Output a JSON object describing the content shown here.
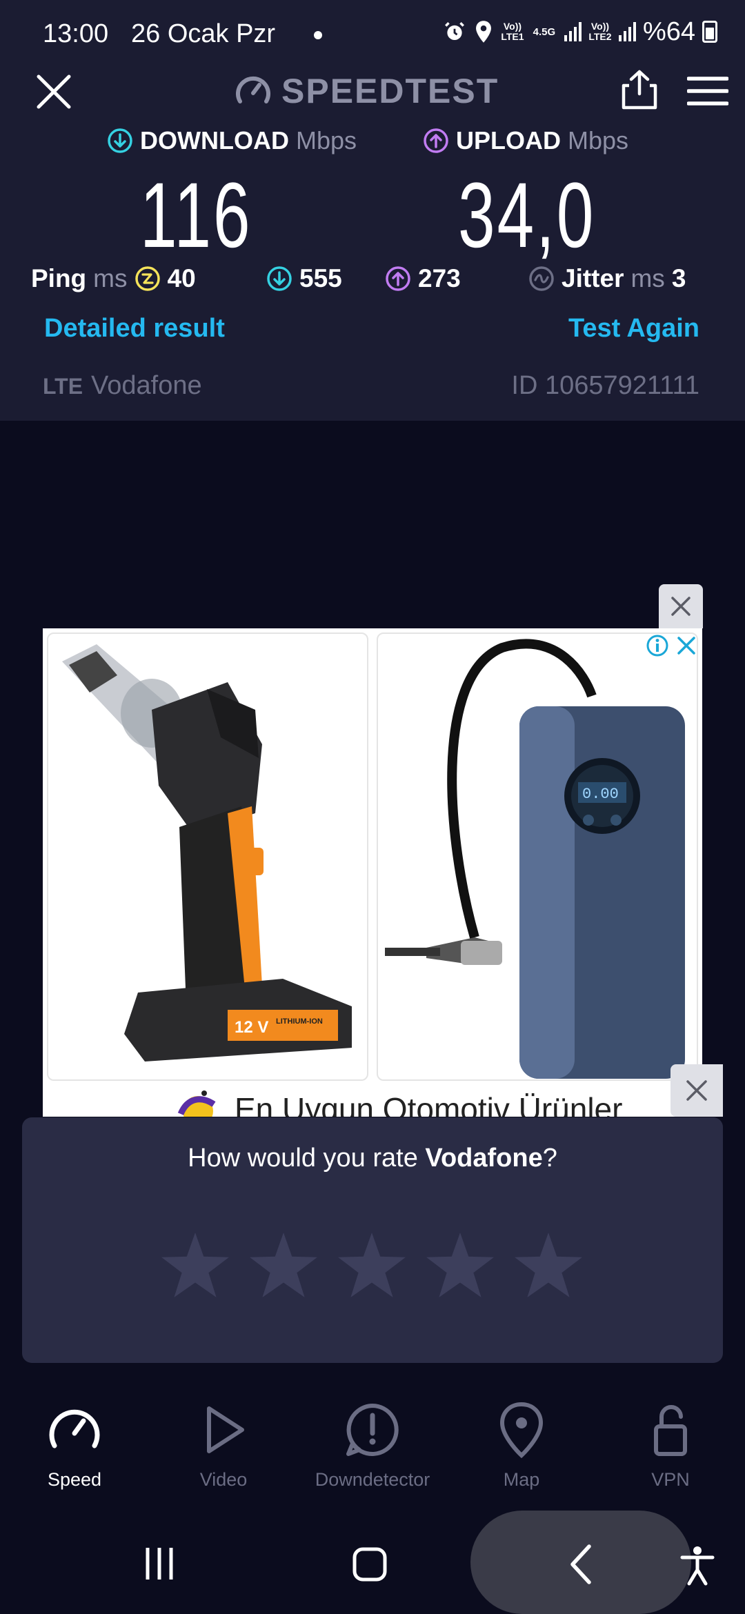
{
  "status_bar": {
    "time": "13:00",
    "date": "26 Ocak Pzr",
    "net1": "Vo)) LTE1",
    "net_type": "4.5G",
    "net2": "Vo)) LTE2",
    "battery": "%64"
  },
  "header": {
    "brand": "SPEEDTEST"
  },
  "results": {
    "download_label": "DOWNLOAD",
    "download_unit": "Mbps",
    "download_value": "116",
    "upload_label": "UPLOAD",
    "upload_unit": "Mbps",
    "upload_value": "34,0",
    "ping_label": "Ping",
    "ping_unit": "ms",
    "ping_value": "40",
    "download_peak": "555",
    "upload_peak": "273",
    "jitter_label": "Jitter",
    "jitter_unit": "ms",
    "jitter_value": "3"
  },
  "links": {
    "detailed": "Detailed result",
    "again": "Test Again"
  },
  "meta": {
    "connection": "LTE",
    "provider": "Vodafone",
    "id": "ID 10657921111"
  },
  "ad": {
    "title": "En Uygun Otomotiv Ürünler",
    "product1_text_1": "12 V",
    "product1_text_2": "LITHIUM-ION",
    "product2_display": "0.00"
  },
  "rating": {
    "question_prefix": "How would you rate ",
    "operator": "Vodafone",
    "question_suffix": "?",
    "stars": 5
  },
  "nav": {
    "items": [
      {
        "label": "Speed"
      },
      {
        "label": "Video"
      },
      {
        "label": "Downdetector"
      },
      {
        "label": "Map"
      },
      {
        "label": "VPN"
      }
    ]
  },
  "colors": {
    "accent_download": "#35d1e2",
    "accent_upload": "#c17cf2",
    "link": "#25b9f0",
    "ping_icon": "#f5e35a"
  }
}
